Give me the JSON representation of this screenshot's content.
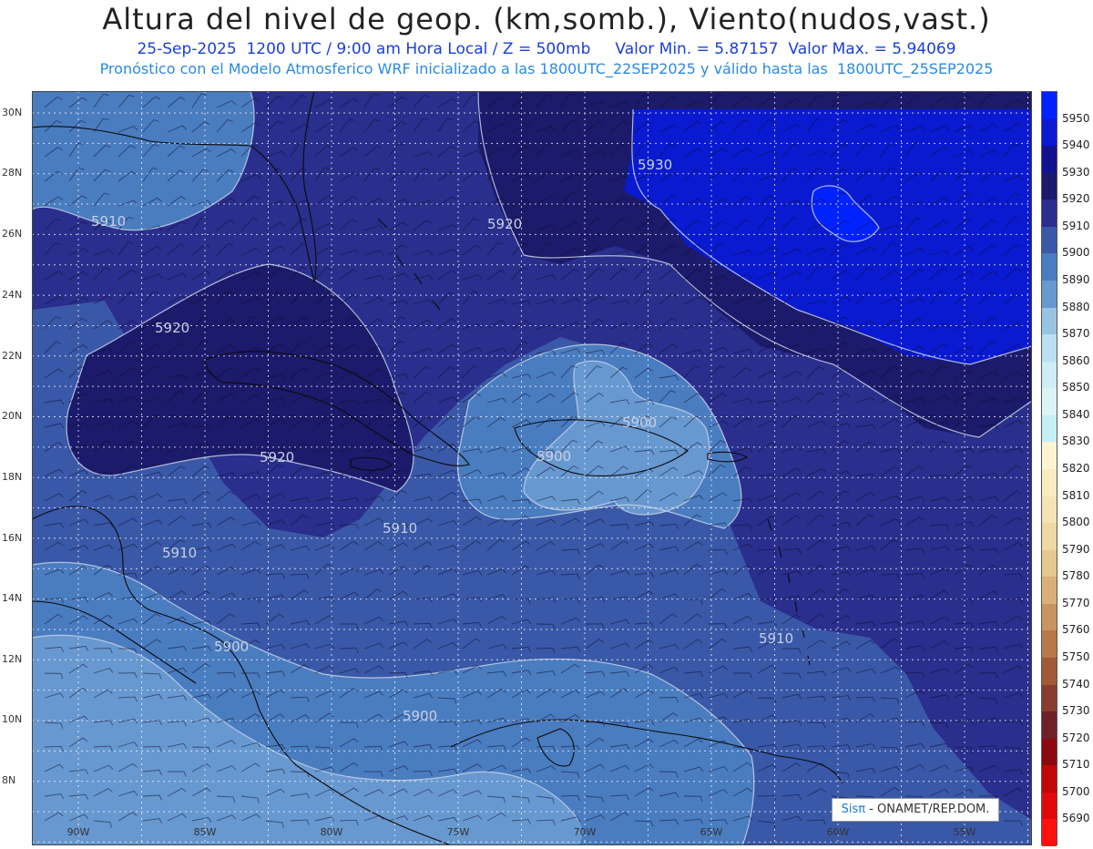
{
  "header": {
    "title": "Altura del nivel de geop. (km,somb.), Viento(nudos,vast.)",
    "subtitle": "25-Sep-2025  1200 UTC / 9:00 am Hora Local / Z = 500mb     Valor Min. = 5.87157  Valor Max. = 5.94069",
    "model_line": "Pronóstico con el Modelo Atmosferico WRF inicializado a las 1800UTC_22SEP2025 y válido hasta las  1800UTC_25SEP2025"
  },
  "map": {
    "lat_labels": [
      "30N",
      "28N",
      "26N",
      "24N",
      "22N",
      "20N",
      "18N",
      "16N",
      "14N",
      "12N",
      "10N",
      "8N"
    ],
    "lon_labels": [
      "90W",
      "85W",
      "80W",
      "75W",
      "70W",
      "65W",
      "60W",
      "55W"
    ],
    "contour_labels": [
      "5910",
      "5920",
      "5930",
      "5920",
      "5920",
      "5910",
      "5910",
      "5900",
      "5900",
      "5900",
      "5910",
      "5900"
    ]
  },
  "colorbar": {
    "labels": [
      "5950",
      "5940",
      "5930",
      "5920",
      "5910",
      "5900",
      "5890",
      "5880",
      "5870",
      "5860",
      "5850",
      "5840",
      "5830",
      "5820",
      "5810",
      "5800",
      "5790",
      "5780",
      "5770",
      "5760",
      "5750",
      "5740",
      "5730",
      "5720",
      "5710",
      "5700",
      "5690"
    ],
    "colors": [
      "#0022ff",
      "#0a1ad0",
      "#12148f",
      "#1c1a6a",
      "#2a2e8c",
      "#3a58a8",
      "#4a7cc0",
      "#6898d0",
      "#98c4e4",
      "#b8e0ee",
      "#cceef4",
      "#dcf4f8",
      "#c4f0f4",
      "#fdf4d4",
      "#f8ecc0",
      "#f4e4b4",
      "#eed8a4",
      "#e4c890",
      "#d8b078",
      "#c89460",
      "#b87848",
      "#a05a38",
      "#883c30",
      "#702028",
      "#8a0a10",
      "#c00808",
      "#e00a0a",
      "#ff1010"
    ]
  },
  "credit": {
    "sis": "Sisπ",
    "text": " - ONAMET/REP.DOM."
  }
}
